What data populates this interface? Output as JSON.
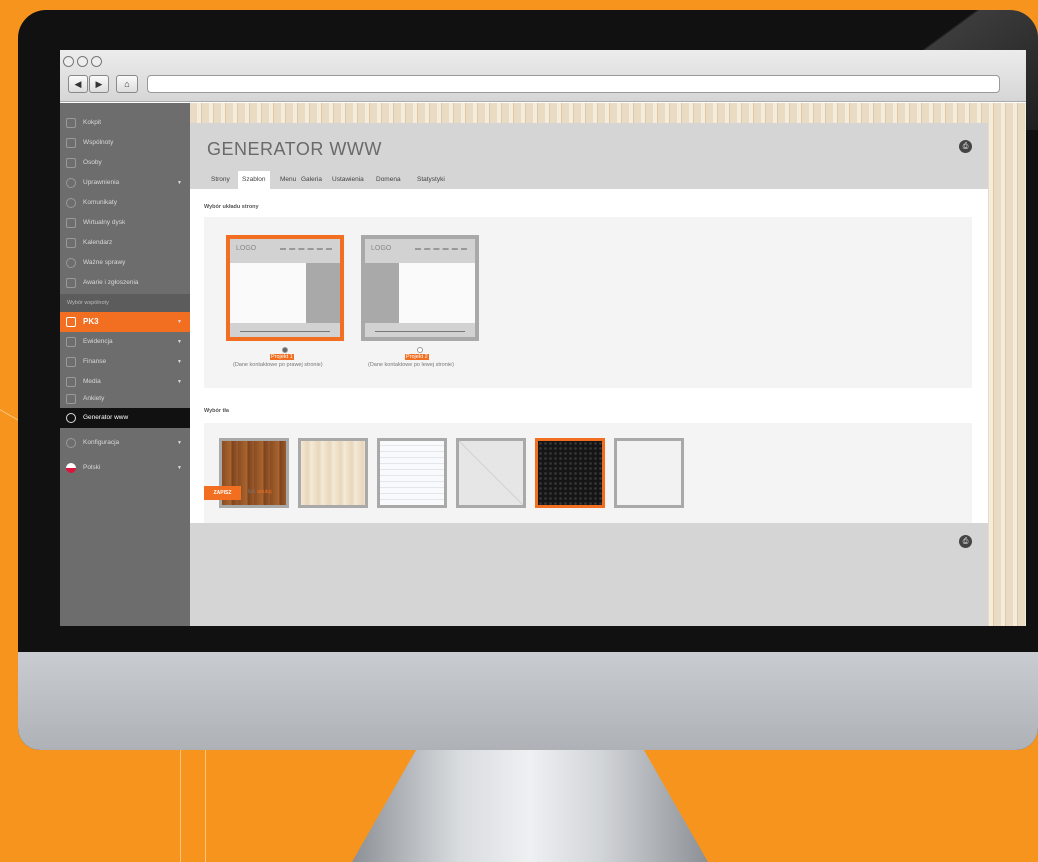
{
  "sidebar": {
    "items": [
      {
        "label": "Kokpit",
        "icon": "dashboard-icon"
      },
      {
        "label": "Wspólnoty",
        "icon": "building-icon"
      },
      {
        "label": "Osoby",
        "icon": "people-icon"
      },
      {
        "label": "Uprawnienia",
        "icon": "gear-icon"
      },
      {
        "label": "Komunikaty",
        "icon": "speech-bubble-icon"
      },
      {
        "label": "Wirtualny dysk",
        "icon": "folder-icon"
      },
      {
        "label": "Kalendarz",
        "icon": "calendar-icon"
      },
      {
        "label": "Ważne sprawy",
        "icon": "alert-icon"
      },
      {
        "label": "Awarie i zgłoszenia",
        "icon": "wrench-icon"
      }
    ],
    "section_label": "Wybór wspólnoty",
    "community": "PK3",
    "sub_items": [
      {
        "label": "Ewidencja",
        "icon": "list-icon"
      },
      {
        "label": "Finanse",
        "icon": "finance-icon"
      },
      {
        "label": "Media",
        "icon": "media-icon"
      },
      {
        "label": "Ankiety",
        "icon": "survey-icon"
      },
      {
        "label": "Generator www",
        "icon": "globe-icon"
      }
    ],
    "settings": {
      "label": "Konfiguracja",
      "icon": "gear-icon"
    },
    "language": {
      "label": "Polski",
      "icon": "poland-flag-icon"
    }
  },
  "page": {
    "title": "GENERATOR WWW",
    "tabs": [
      "Strony",
      "Szablon",
      "Menu",
      "Galeria",
      "Ustawienia",
      "Domena",
      "Statystyki"
    ],
    "active_tab": "Szablon",
    "layout_section": "Wybór układu strony",
    "layouts": [
      {
        "logo": "LOGO",
        "name": "Projekt 1",
        "desc": "(Dane kontaktowe po prawej stronie)",
        "selected": true
      },
      {
        "logo": "LOGO",
        "name": "Projekt 2",
        "desc": "(Dane kontaktowe po lewej stronie)",
        "selected": false
      }
    ],
    "bg_section": "Wybór tła",
    "backgrounds": [
      {
        "name": "dark-wood",
        "color": "#9a5a2b",
        "selected": false
      },
      {
        "name": "light-wood",
        "color": "#efe2cc",
        "selected": false
      },
      {
        "name": "white-lines",
        "color": "#f4f6f8",
        "selected": false
      },
      {
        "name": "light-gray-pattern",
        "color": "#ececec",
        "selected": false
      },
      {
        "name": "black-dots",
        "color": "#1a1a1a",
        "selected": true
      },
      {
        "name": "white-texture",
        "color": "#f2f2f2",
        "selected": false
      }
    ],
    "save_label": "ZAPISZ",
    "or_label": "lub ",
    "cancel_label": "anuluj"
  },
  "colors": {
    "accent": "#f26f21",
    "brand_orange": "#f7941d"
  }
}
